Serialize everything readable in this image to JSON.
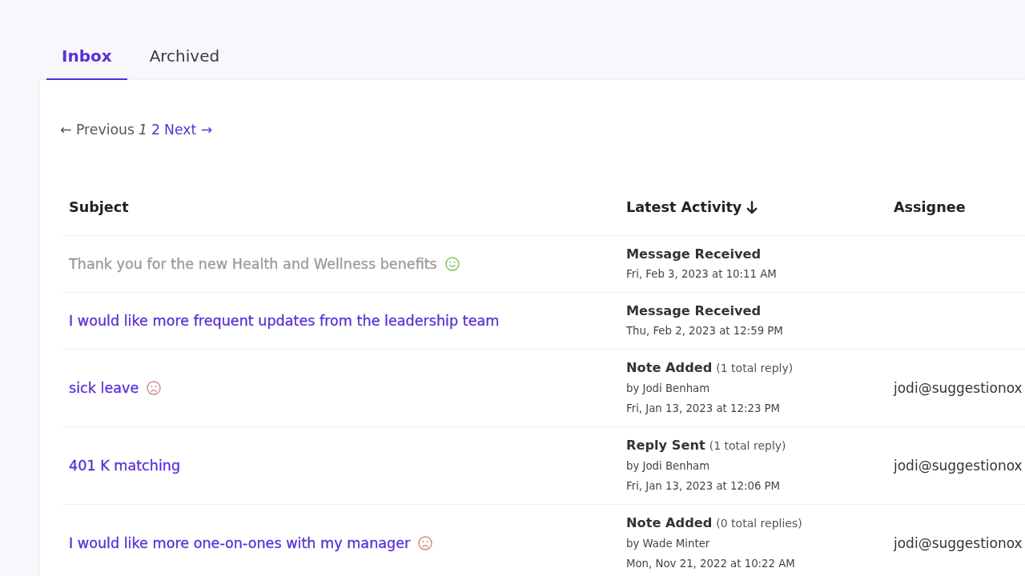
{
  "tabs": [
    {
      "label": "Inbox",
      "selected": true
    },
    {
      "label": "Archived",
      "selected": false
    }
  ],
  "pagination": {
    "previous": {
      "label": "← Previous",
      "disabled": true
    },
    "pages": [
      {
        "label": "1",
        "selected": true
      },
      {
        "label": "2",
        "selected": false
      }
    ],
    "next": {
      "label": "Next →",
      "disabled": false
    }
  },
  "table": {
    "columns": [
      {
        "label": "Subject",
        "sorted": false
      },
      {
        "label": "Latest Activity",
        "sorted": true
      },
      {
        "label": "Assignee",
        "sorted": false
      }
    ],
    "rows": [
      {
        "subject": "Thank you for the new Health and Wellness benefits",
        "read": true,
        "emoji": {
          "kind": "smile"
        },
        "activity": {
          "action": "Message Received",
          "date": "Fri, Feb 3, 2023 at 10:11 AM"
        }
      },
      {
        "subject": "I would like more frequent updates from the leadership team",
        "read": false,
        "activity": {
          "action": "Message Received",
          "date": "Thu, Feb 2, 2023 at 12:59 PM"
        }
      },
      {
        "subject": "sick leave",
        "read": false,
        "emoji": {
          "kind": "frown"
        },
        "activity": {
          "action": "Note Added",
          "replies": "(1 total reply)",
          "author": "by Jodi Benham",
          "date": "Fri, Jan 13, 2023 at 12:23 PM"
        },
        "assignee": "jodi@suggestionox"
      },
      {
        "subject": "401 K matching",
        "read": false,
        "activity": {
          "action": "Reply Sent",
          "replies": "(1 total reply)",
          "author": "by Jodi Benham",
          "date": "Fri, Jan 13, 2023 at 12:06 PM"
        },
        "assignee": "jodi@suggestionox"
      },
      {
        "subject": "I would like more one-on-ones with my manager",
        "read": false,
        "emoji": {
          "kind": "frown"
        },
        "activity": {
          "action": "Note Added",
          "replies": "(0 total replies)",
          "author": "by Wade Minter",
          "date": "Mon, Nov 21, 2022 at 10:22 AM"
        },
        "assignee": "jodi@suggestionox"
      }
    ]
  }
}
